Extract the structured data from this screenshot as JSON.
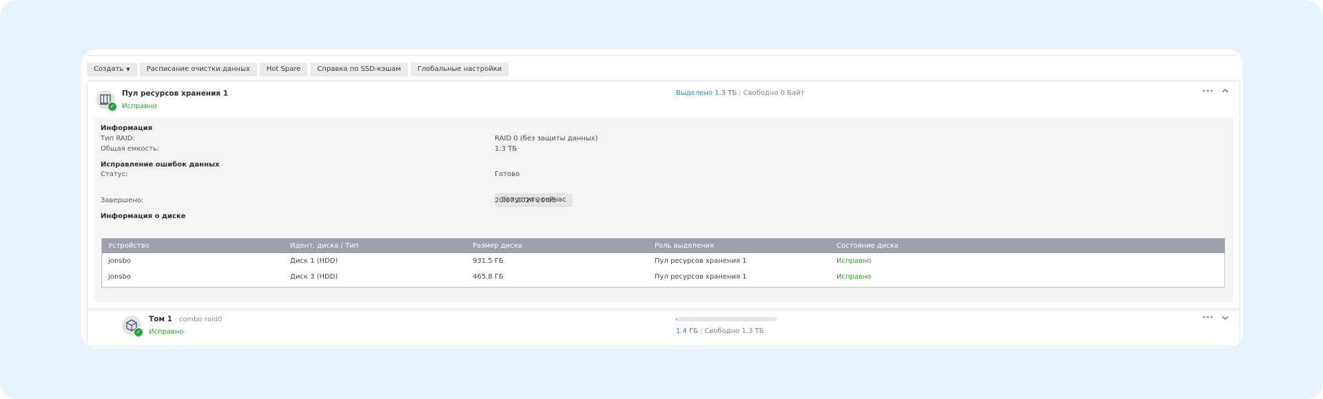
{
  "toolbar": {
    "create_label": "Создать",
    "scrub_schedule_label": "Расписание очистки данных",
    "hot_spare_label": "Hot Spare",
    "ssd_cache_help_label": "Справка по SSD-кэшам",
    "global_settings_label": "Глобальные настройки"
  },
  "pool": {
    "title": "Пул ресурсов хранения 1",
    "status": "Исправно",
    "allocated": "Выделено 1.3 ТБ",
    "separator": "|",
    "free": "Свободно 0 Байт",
    "info": {
      "heading": "Информация",
      "raid_type_label": "Тип RAID:",
      "raid_type_value": "RAID 0 (без защиты данных)",
      "capacity_label": "Общая емкость:",
      "capacity_value": "1.3 ТБ"
    },
    "scrubbing": {
      "heading": "Исправление ошибок данных",
      "status_label": "Статус:",
      "status_value": "Готово",
      "run_now_label": "Запустить сейчас",
      "completed_label": "Завершено:",
      "completed_value": "20.07.2024 20:05"
    },
    "disks": {
      "heading": "Информация о диске",
      "columns": [
        "Устройство",
        "Идент. диска / Тип",
        "Размер диска",
        "Роль выделения",
        "Состояние диска"
      ],
      "rows": [
        [
          "jonsbo",
          "Диск 1 (HDD)",
          "931.5 ГБ",
          "Пул ресурсов хранения 1",
          "Исправно"
        ],
        [
          "jonsbo",
          "Диск 3 (HDD)",
          "465.8 ГБ",
          "Пул ресурсов хранения 1",
          "Исправно"
        ]
      ]
    }
  },
  "volume": {
    "title": "Том 1",
    "dot": "·",
    "subtitle": "combo raid0",
    "status": "Исправно",
    "used": "1.4 ГБ",
    "separator": "|",
    "free": "Свободно 1.3 ТБ",
    "usage_fraction": 0.001
  },
  "colors": {
    "accent": "#1e84d8",
    "healthy": "#2ca02c",
    "page_bg": "#e8f3fe"
  },
  "icons": {
    "pool": "storage-pool-icon",
    "volume": "volume-cube-icon",
    "status_ok": "check-circle-icon",
    "more": "more-dots-icon",
    "collapse": "chevron-up-icon",
    "expand": "chevron-down-icon",
    "dropdown": "caret-down-icon"
  }
}
